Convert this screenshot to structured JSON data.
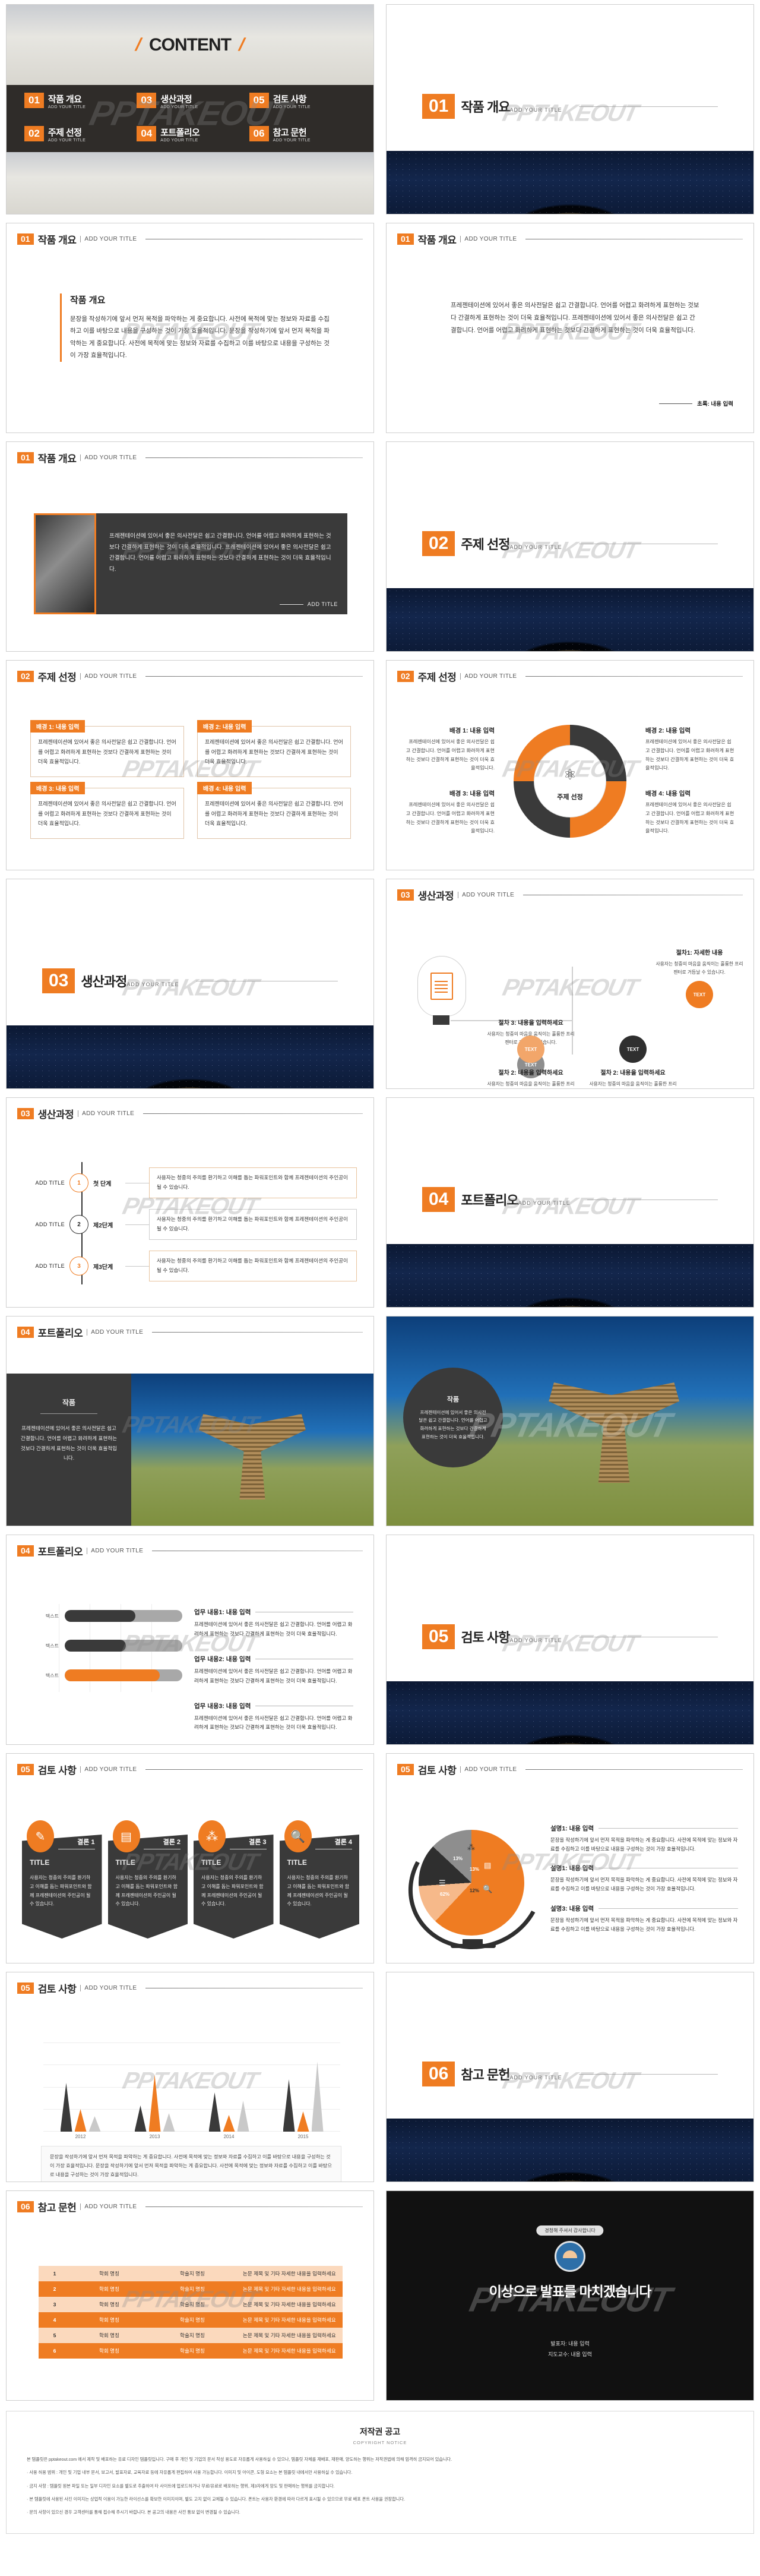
{
  "brand": {
    "accent": "#ef7c22",
    "dark": "#3a3a3a",
    "watermark": "PPTAKEOUT"
  },
  "content_slide": {
    "title": "CONTENT",
    "items": [
      {
        "num": "01",
        "label": "작품 개요",
        "sub": "ADD YOUR TITLE"
      },
      {
        "num": "02",
        "label": "주제 선정",
        "sub": "ADD YOUR TITLE"
      },
      {
        "num": "03",
        "label": "생산과정",
        "sub": "ADD YOUR TITLE"
      },
      {
        "num": "04",
        "label": "포트폴리오",
        "sub": "ADD YOUR TITLE"
      },
      {
        "num": "05",
        "label": "검토 사항",
        "sub": "ADD YOUR TITLE"
      },
      {
        "num": "06",
        "label": "참고 문헌",
        "sub": "ADD YOUR TITLE"
      }
    ]
  },
  "sections": {
    "s1": {
      "num": "01",
      "title": "작품 개요",
      "sub": "ADD YOUR TITLE"
    },
    "s2": {
      "num": "02",
      "title": "주제 선정",
      "sub": "ADD YOUR TITLE"
    },
    "s3": {
      "num": "03",
      "title": "생산과정",
      "sub": "ADD YOUR TITLE"
    },
    "s4": {
      "num": "04",
      "title": "포트폴리오",
      "sub": "ADD YOUR TITLE"
    },
    "s5": {
      "num": "05",
      "title": "검토 사항",
      "sub": "ADD YOUR TITLE"
    },
    "s6": {
      "num": "06",
      "title": "참고 문헌",
      "sub": "ADD YOUR TITLE"
    }
  },
  "header_sub": "ADD YOUR TITLE",
  "body": {
    "p_jakpum": "문장을 작성하기에 앞서 먼저 목적을 파악하는 게 중요합니다. 사전에 목적에 맞는 정보와 자료를 수집하고 이를 바탕으로 내용을 구성하는 것이 가장 효율적입니다. 문장을 작성하기에 앞서 먼저 목적을 파악하는 게 중요합니다. 사전에 목적에 맞는 정보와 자료를 수집하고 이를 바탕으로 내용을 구성하는 것이 가장 효율적입니다.",
    "p_present": "프레젠테이션에 있어서 좋은 의사전달은 쉽고 간결합니다. 언어를 어렵고 화려하게 표현하는 것보다 간결하게 표현하는 것이 더욱 효율적입니다. 프레젠테이션에 있어서 좋은 의사전달은 쉽고 간결합니다. 언어를 어렵고 화려하게 표현하는 것보다 간결하게 표현하는 것이 더욱 효율적입니다.",
    "p_present_short": "프레젠테이션에 있어서 좋은 의사전달은 쉽고 간결합니다. 언어를 어렵고 화려하게 표현하는 것보다 간결하게 표현하는 것이 더욱 효율적입니다.",
    "p_audience": "사용자는 청중의 주의를 환기하고 이해를 돕는 파워포인트와 함께 프레젠테이션의 주인공이 될 수 있습니다.",
    "p_presenter": "사용자는 청중의 마음을 움직이는 훌륭한 프리젠터로 거듭날 수 있습니다.",
    "p_purpose": "문장을 작성하기에 앞서 먼저 목적을 파악하는 게 중요합니다. 사전에 목적에 맞는 정보와 자료를 수집하고 이를 바탕으로 내용을 구성하는 것이 가장 효율적입니다."
  },
  "slide_overview1": {
    "heading": "작품 개요"
  },
  "slide_overview2": {
    "abstract_label": "초록: 내용 입력"
  },
  "slide_overview3": {
    "add_title": "ADD TITLE"
  },
  "slide_topic_boxes": {
    "boxes": [
      {
        "cap": "배경 1: 내용 입력"
      },
      {
        "cap": "배경 2: 내용 입력"
      },
      {
        "cap": "배경 3: 내용 입력"
      },
      {
        "cap": "배경 4: 내용 입력"
      }
    ]
  },
  "slide_topic_donut": {
    "center_label": "주제 선정",
    "center_icon": "atom-icon",
    "notes": [
      {
        "h": "배경 1: 내용 입력"
      },
      {
        "h": "배경 2: 내용 입력"
      },
      {
        "h": "배경 3: 내용 입력"
      },
      {
        "h": "배경 4: 내용 입력"
      }
    ]
  },
  "slide_process_circles": {
    "steps": [
      {
        "h": "절차 3: 내용을 입력하세요",
        "badge": "TEXT"
      },
      {
        "h": "절차1: 자세한 내용",
        "badge": "TEXT"
      },
      {
        "h": "절차 2: 내용을 입력하세요",
        "badge": "TEXT"
      },
      {
        "h": "절차 2: 내용을 입력하세요",
        "badge": "TEXT"
      }
    ]
  },
  "slide_timeline": {
    "rows": [
      {
        "add": "ADD TITLE",
        "n": "1",
        "stage": "첫 단계"
      },
      {
        "add": "ADD TITLE",
        "n": "2",
        "stage": "제2단계"
      },
      {
        "add": "ADD TITLE",
        "n": "3",
        "stage": "제3단계"
      }
    ]
  },
  "slide_portfolio_img": {
    "caption": "작품"
  },
  "slide_portfolio_bars": {
    "chart_rows": [
      {
        "label": "텍스트",
        "value": 60,
        "color": "#3a3a3a"
      },
      {
        "label": "텍스트",
        "value": 52,
        "color": "#3a3a3a"
      },
      {
        "label": "텍스트",
        "value": 81,
        "color": "#ef7c22"
      }
    ],
    "descriptions": [
      {
        "h": "업무 내용1: 내용 입력"
      },
      {
        "h": "업무 내용2: 내용 입력"
      },
      {
        "h": "업무 내용3: 내용 입력"
      }
    ]
  },
  "slide_review_panels": {
    "panels": [
      {
        "kr": "결론 1",
        "title": "TITLE",
        "icon": "pencil-icon"
      },
      {
        "kr": "결론 2",
        "title": "TITLE",
        "icon": "clipboard-icon"
      },
      {
        "kr": "결론 3",
        "title": "TITLE",
        "icon": "network-icon"
      },
      {
        "kr": "결론 4",
        "title": "TITLE",
        "icon": "document-search-icon"
      }
    ]
  },
  "slide_review_pie": {
    "descriptions": [
      {
        "h": "설명1: 내용 입력"
      },
      {
        "h": "설명1: 내용 입력"
      },
      {
        "h": "설명3: 내용 입력"
      }
    ]
  },
  "slide_review_chart": {
    "note": "문장을 작성하기에 앞서 먼저 목적을 파악하는 게 중요합니다. 사전에 목적에 맞는 정보와 자료를 수집하고 이를 바탕으로 내용을 구성하는 것이 가장 효율적입니다. 문장을 작성하기에 앞서 먼저 목적을 파악하는 게 중요합니다. 사전에 목적에 맞는 정보와 자료를 수집하고 이를 바탕으로 내용을 구성하는 것이 가장 효율적입니다."
  },
  "slide_reference_table": {
    "rows": [
      {
        "idx": "1",
        "c2": "학회 명칭",
        "c3": "학술지 명칭",
        "c4": "논문 제목 및 기타 자세한 내용을 입력하세요"
      },
      {
        "idx": "2",
        "c2": "학회 명칭",
        "c3": "학술지 명칭",
        "c4": "논문 제목 및 기타 자세한 내용을 입력하세요"
      },
      {
        "idx": "3",
        "c2": "학회 명칭",
        "c3": "학술지 명칭",
        "c4": "논문 제목 및 기타 자세한 내용을 입력하세요"
      },
      {
        "idx": "4",
        "c2": "학회 명칭",
        "c3": "학술지 명칭",
        "c4": "논문 제목 및 기타 자세한 내용을 입력하세요"
      },
      {
        "idx": "5",
        "c2": "학회 명칭",
        "c3": "학술지 명칭",
        "c4": "논문 제목 및 기타 자세한 내용을 입력하세요"
      },
      {
        "idx": "6",
        "c2": "학회 명칭",
        "c3": "학술지 명칭",
        "c4": "논문 제목 및 기타 자세한 내용을 입력하세요"
      }
    ]
  },
  "slide_closing": {
    "badge": "경청해 주셔서 감사합니다",
    "title": "이상으로 발표를 마치겠습니다",
    "line1": "발표자: 내용 입력",
    "line2": "지도교수: 내용 입력"
  },
  "copyright": {
    "title": "저작권 공고",
    "en": "COPYRIGHT NOTICE",
    "p1": "본 템플릿은 pptakeout.com 에서 제작 및 배포하는 유료 디자인 템플릿입니다. 구매 후 개인 및 기업의 문서 작성 용도로 자유롭게 사용하실 수 있으나, 템플릿 자체를 재배포, 재판매, 양도하는 행위는 저작권법에 의해 엄격히 금지되어 있습니다.",
    "p2": "· 사용 허용 범위 : 개인 및 기업 내부 문서, 보고서, 발표자료, 교육자료 등에 자유롭게 편집하여 사용 가능합니다. 이미지 및 아이콘, 도형 요소는 본 템플릿 내에서만 사용하실 수 있습니다.",
    "p3": "· 금지 사항 : 템플릿 원본 파일 또는 일부 디자인 요소를 별도로 추출하여 타 사이트에 업로드하거나 무료/유료로 배포하는 행위, 제3자에게 양도 및 판매하는 행위를 금지합니다.",
    "p4": "· 본 템플릿에 사용된 사진 이미지는 상업적 이용이 가능한 라이선스를 확보한 이미지이며, 별도 고지 없이 교체될 수 있습니다. 폰트는 사용자 환경에 따라 다르게 표시될 수 있으므로 무료 배포 폰트 사용을 권장합니다.",
    "p5": "· 문의 사항이 있으신 경우 고객센터를 통해 접수해 주시기 바랍니다. 본 공고의 내용은 사전 통보 없이 변경될 수 있습니다."
  }
}
